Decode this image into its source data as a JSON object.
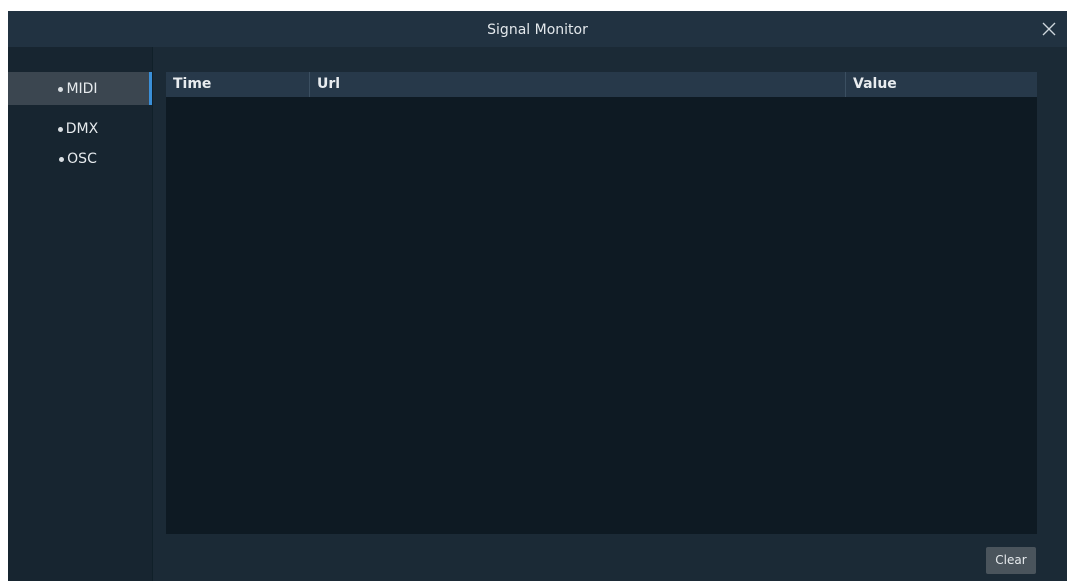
{
  "window": {
    "title": "Signal Monitor",
    "close_icon": "close-icon"
  },
  "sidebar": {
    "items": [
      {
        "label": "MIDI",
        "active": true
      },
      {
        "label": "DMX",
        "active": false
      },
      {
        "label": "OSC",
        "active": false
      }
    ]
  },
  "table": {
    "columns": [
      "Time",
      "Url",
      "Value"
    ],
    "rows": []
  },
  "footer": {
    "clear_label": "Clear"
  },
  "colors": {
    "accent": "#3a8fd8",
    "window_bg": "#1b2a36",
    "table_bg": "#0e1a23"
  }
}
